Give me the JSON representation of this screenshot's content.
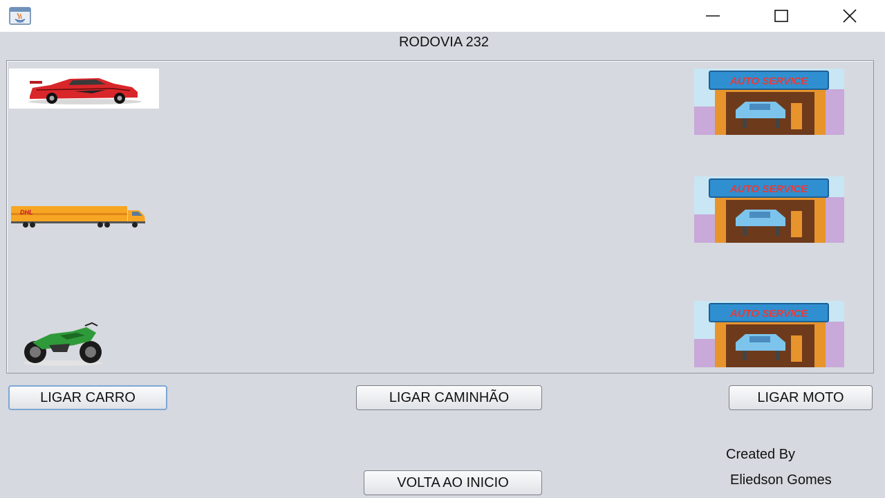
{
  "window": {
    "title": "RODOVIA 232",
    "controls": {
      "minimize_icon": "minimize-icon",
      "maximize_icon": "maximize-icon",
      "close_icon": "close-icon"
    },
    "app_icon": "java-icon"
  },
  "road": {
    "vehicles": [
      {
        "kind": "car",
        "icon": "red-sports-car-image"
      },
      {
        "kind": "truck",
        "icon": "dhl-truck-image",
        "label": "DHL"
      },
      {
        "kind": "motorcycle",
        "icon": "green-motorcycle-image"
      }
    ],
    "garages": [
      {
        "icon": "auto-service-garage-image",
        "sign": "AUTO SERVICE"
      },
      {
        "icon": "auto-service-garage-image",
        "sign": "AUTO SERVICE"
      },
      {
        "icon": "auto-service-garage-image",
        "sign": "AUTO SERVICE"
      }
    ]
  },
  "buttons": {
    "ligar_carro": "LIGAR CARRO",
    "ligar_caminhao": "LIGAR CAMINHÃO",
    "ligar_moto": "LIGAR MOTO",
    "voltar": "VOLTA AO INICIO"
  },
  "credits": {
    "line1": "Created By",
    "line2": "Eliedson Gomes"
  },
  "colors": {
    "background": "#d6d9df",
    "titlebar": "#ffffff",
    "focus_border": "#7ea6d6",
    "garage_sign": "#2f8fd0",
    "garage_wall": "#e8942c",
    "car_red": "#d9262a",
    "truck_yellow": "#f6a623",
    "moto_green": "#2f9a3a"
  }
}
